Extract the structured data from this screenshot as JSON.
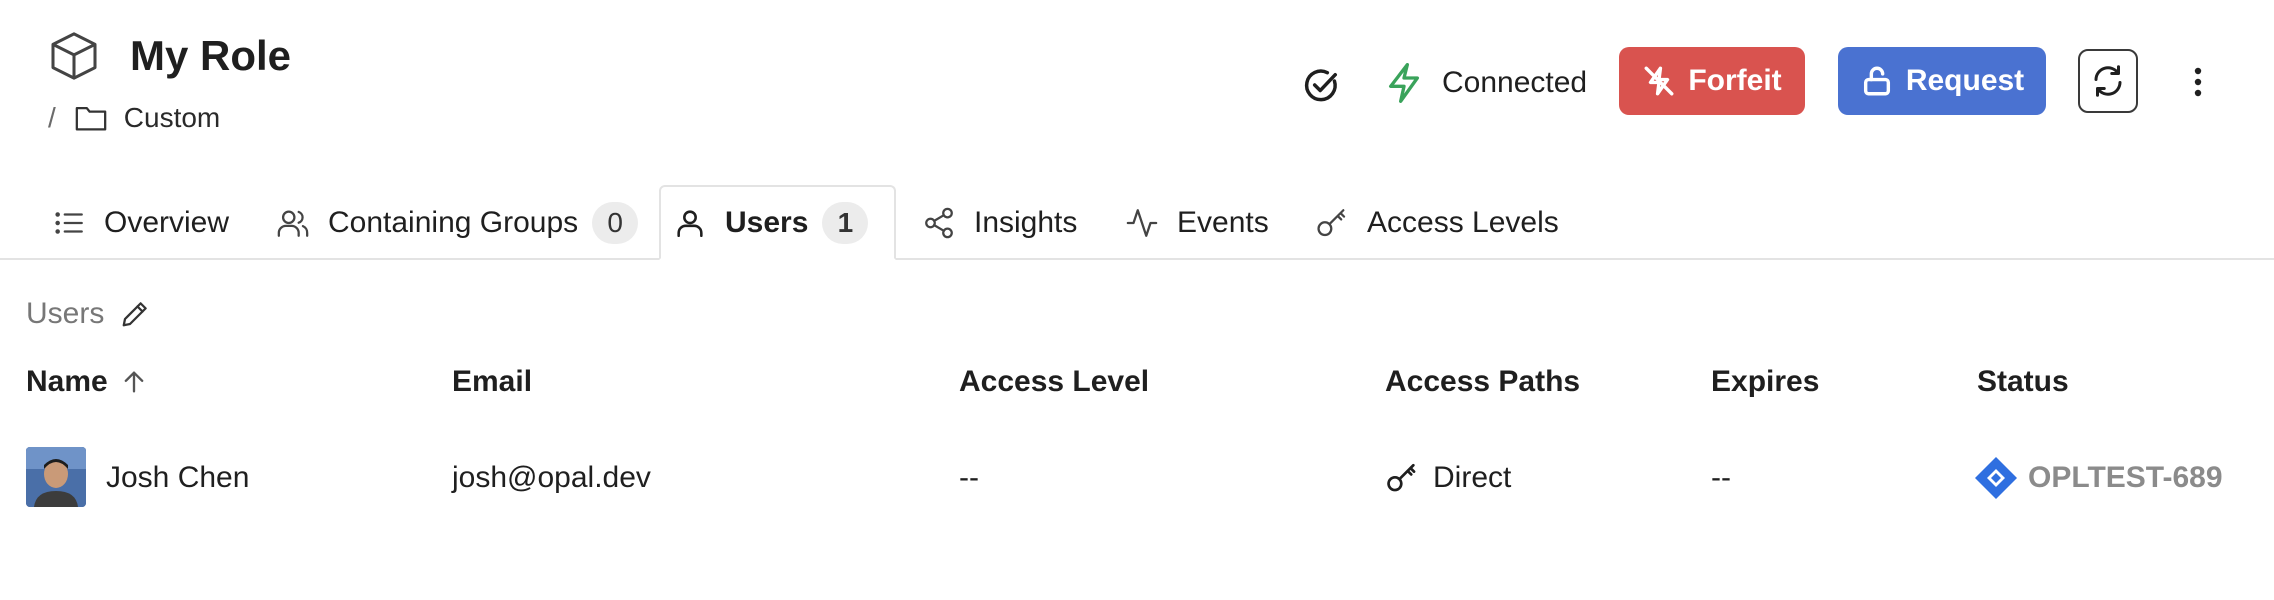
{
  "header": {
    "title": "My Role",
    "breadcrumb_separator": "/",
    "breadcrumb_folder": "Custom",
    "connection_status": "Connected",
    "forfeit_label": "Forfeit",
    "request_label": "Request"
  },
  "tabs": [
    {
      "label": "Overview",
      "icon": "list-icon"
    },
    {
      "label": "Containing Groups",
      "count": "0",
      "icon": "users-group-icon"
    },
    {
      "label": "Users",
      "count": "1",
      "icon": "user-icon",
      "active": true
    },
    {
      "label": "Insights",
      "icon": "share-nodes-icon"
    },
    {
      "label": "Events",
      "icon": "activity-icon"
    },
    {
      "label": "Access Levels",
      "icon": "key-icon"
    }
  ],
  "section": {
    "label": "Users"
  },
  "table": {
    "columns": [
      "Name",
      "Email",
      "Access Level",
      "Access Paths",
      "Expires",
      "Status"
    ],
    "sort": {
      "column": "Name",
      "direction": "ascending"
    },
    "rows": [
      {
        "name": "Josh Chen",
        "email": "josh@opal.dev",
        "access_level": "--",
        "access_path": "Direct",
        "expires": "--",
        "status": "OPLTEST-689"
      }
    ]
  },
  "colors": {
    "forfeit": "#d9534f",
    "request": "#4a72d1",
    "connected": "#3aa35b",
    "jira": "#2f6fe0"
  }
}
